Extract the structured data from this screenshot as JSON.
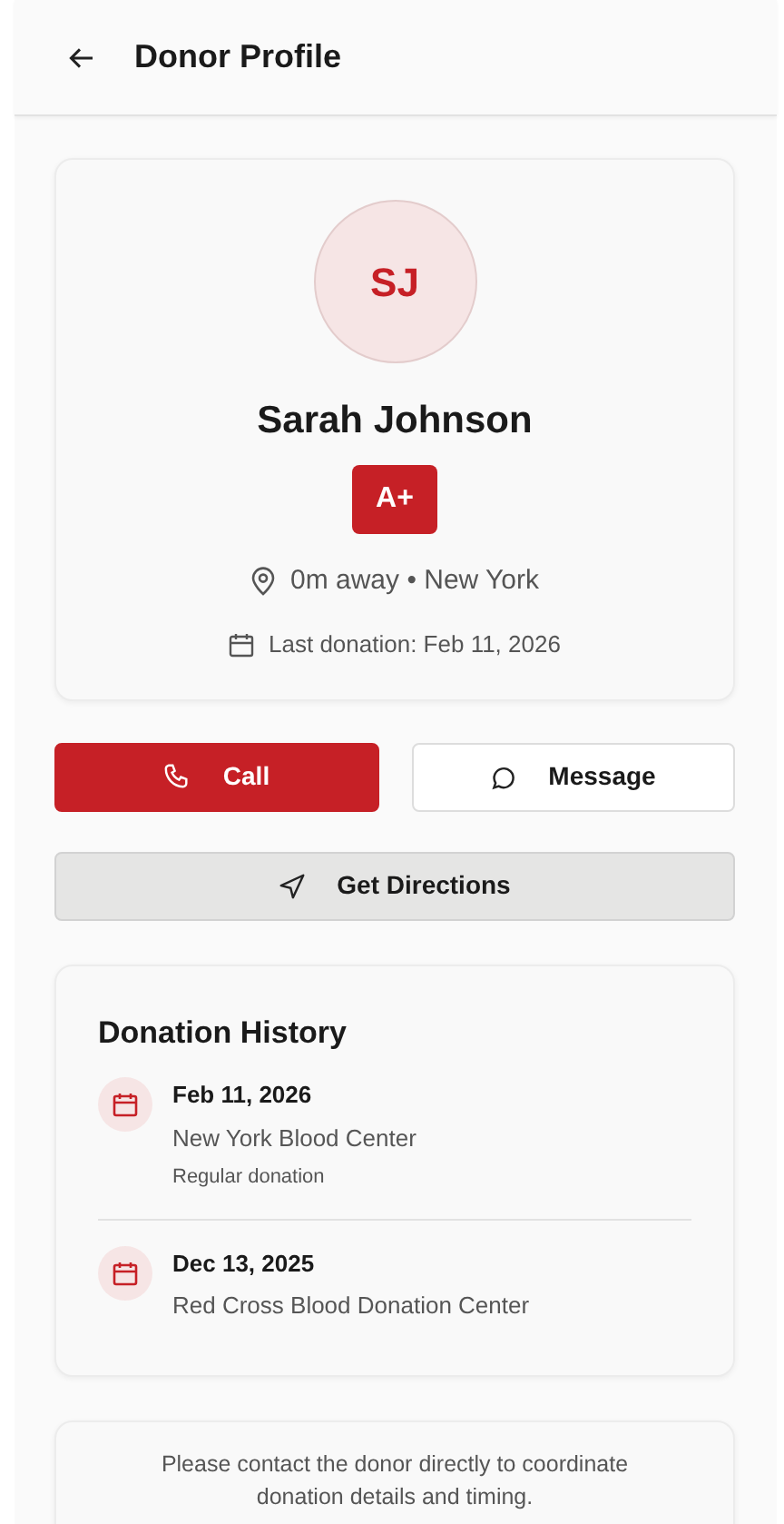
{
  "header": {
    "title": "Donor Profile"
  },
  "profile": {
    "initials": "SJ",
    "name": "Sarah Johnson",
    "blood_type": "A+",
    "location": "0m away • New York",
    "last_donation": "Last donation: Feb 11, 2026"
  },
  "actions": [
    {
      "kind": "primary",
      "label": "Call"
    },
    {
      "kind": "outline",
      "label": "Message"
    },
    {
      "kind": "secondary",
      "label": "Get Directions"
    }
  ],
  "history": {
    "title": "Donation History",
    "items": [
      {
        "date": "Feb 11, 2026",
        "center": "New York Blood Center",
        "note": "Regular donation"
      },
      {
        "date": "Dec 13, 2025",
        "center": "Red Cross Blood Donation Center"
      }
    ]
  },
  "notice": "Please contact the donor directly to coordinate donation details and timing."
}
